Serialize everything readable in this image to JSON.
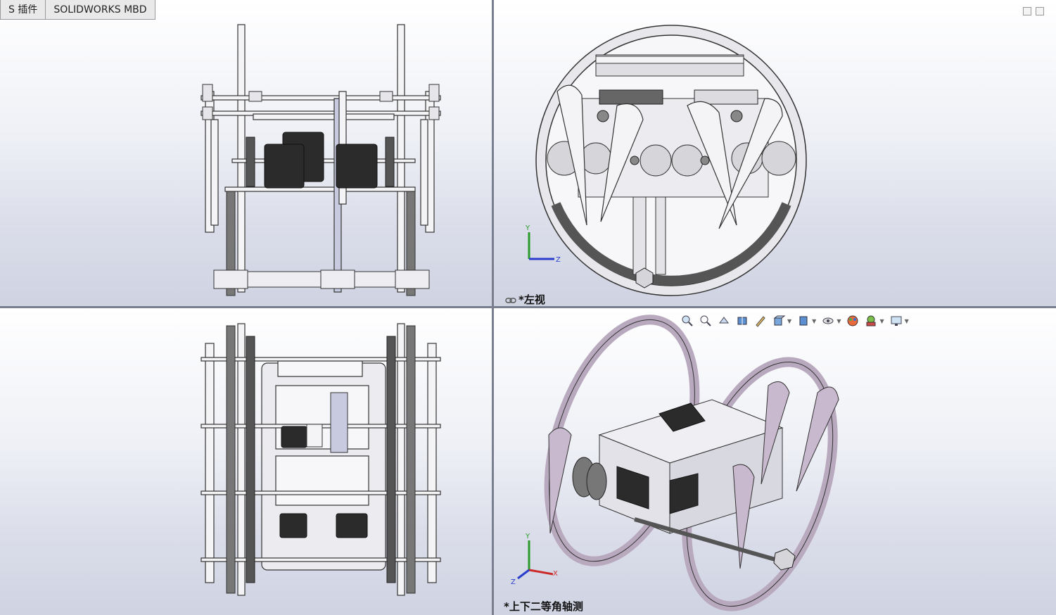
{
  "tabs": [
    {
      "label": "S 插件"
    },
    {
      "label": "SOLIDWORKS MBD"
    }
  ],
  "viewports": {
    "top_right_label": "*左视",
    "bottom_right_label": "*上下二等角轴测"
  },
  "triad": {
    "y_label": "Y",
    "z_label": "Z",
    "x_label": "X"
  },
  "icons": [
    "zoom-to-fit-icon",
    "zoom-area-icon",
    "previous-view-icon",
    "section-view-icon",
    "dynamic-annotation-icon",
    "view-orientation-icon",
    "display-style-icon",
    "hide-show-icon",
    "edit-appearance-icon",
    "apply-scene-icon",
    "view-settings-icon"
  ],
  "colors": {
    "split": "#7a7f8f",
    "part_outline": "#333333",
    "motor": "#2b2b2b",
    "wheel_purple": "#b9a9bf"
  }
}
